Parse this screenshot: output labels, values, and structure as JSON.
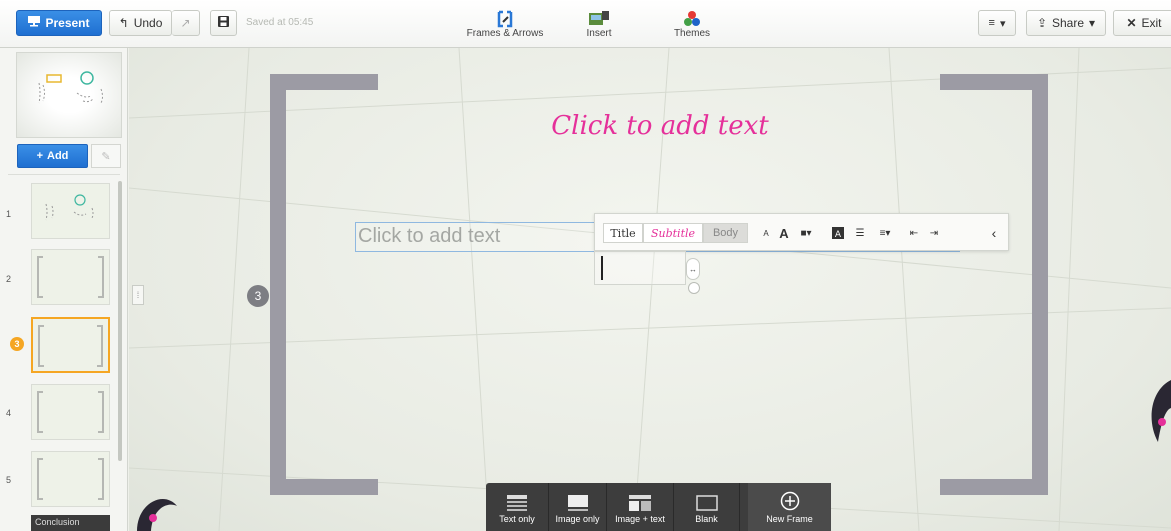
{
  "toolbar": {
    "present_label": "Present",
    "undo_label": "Undo",
    "saved_status": "Saved at 05:45",
    "tools": [
      {
        "label": "Frames & Arrows"
      },
      {
        "label": "Insert"
      },
      {
        "label": "Themes"
      }
    ],
    "share_label": "Share",
    "exit_label": "Exit"
  },
  "sidebar": {
    "add_label": "Add",
    "slides": [
      {
        "number": "1"
      },
      {
        "number": "2"
      },
      {
        "number": "3"
      },
      {
        "number": "4"
      },
      {
        "number": "5"
      }
    ],
    "active_slide": "3",
    "conclusion_label": "Conclusion"
  },
  "canvas": {
    "frame_number": "3",
    "title_placeholder": "Click to add text",
    "body_placeholder": "Click to add text"
  },
  "format_bar": {
    "title_label": "Title",
    "subtitle_label": "Subtitle",
    "body_label": "Body"
  },
  "layout_bar": {
    "options": [
      {
        "label": "Text only"
      },
      {
        "label": "Image only"
      },
      {
        "label": "Image + text"
      },
      {
        "label": "Blank"
      },
      {
        "label": "New Frame"
      }
    ]
  },
  "colors": {
    "accent_blue": "#1f6fd1",
    "title_pink": "#e5309a",
    "active_orange": "#f5a623",
    "bracket_gray": "#9c9ba4"
  }
}
